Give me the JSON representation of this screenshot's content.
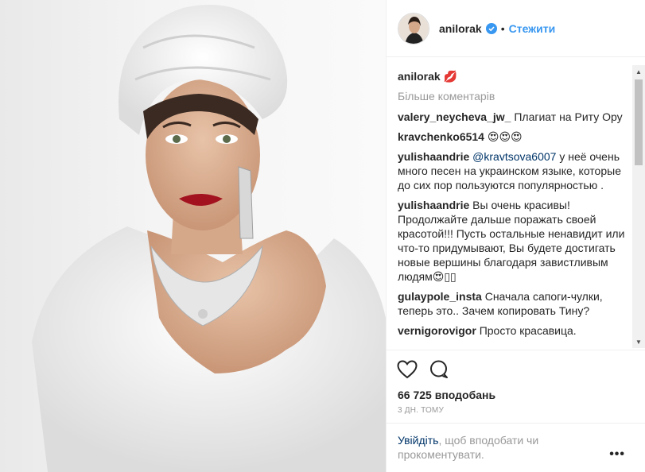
{
  "post": {
    "author": "anilorak",
    "follow_label": "Стежити",
    "caption_emoji": "💋",
    "more_comments": "Більше коментарів",
    "comments": [
      {
        "user": "valery_neycheva_jw_",
        "text": "Плагиат на Риту Ору"
      },
      {
        "user": "kravchenko6514",
        "text": "😍😍😍"
      },
      {
        "user": "yulishaandrie",
        "mention": "@kravtsova6007",
        "text": "у неё очень много песен на украинском языке, которые до сих пор пользуются популярностью ."
      },
      {
        "user": "yulishaandrie",
        "text": "Вы очень красивы! Продолжайте дальше поражать своей красотой!!! Пусть остальные ненавидит или что-то придумывают, Вы будете достигать новые вершины благодаря завистливым людям😍▯▯"
      },
      {
        "user": "gulaypole_insta",
        "text": "Сначала сапоги-чулки, теперь это.. Зачем копировать Тину?"
      },
      {
        "user": "vernigorovigor",
        "text": "Просто красавица."
      }
    ],
    "likes_label": "66 725 вподобань",
    "time_label": "3 ДН. ТОМУ",
    "login_link": "Увійдіть",
    "login_text": ", щоб вподобати чи прокоментувати.",
    "menu_label": "•••"
  },
  "icons": {
    "verified": "verified-badge-icon",
    "like": "heart-icon",
    "comment": "comment-bubble-icon"
  },
  "colors": {
    "link": "#3897f0",
    "dark_link": "#003569",
    "secondary": "#999999"
  }
}
